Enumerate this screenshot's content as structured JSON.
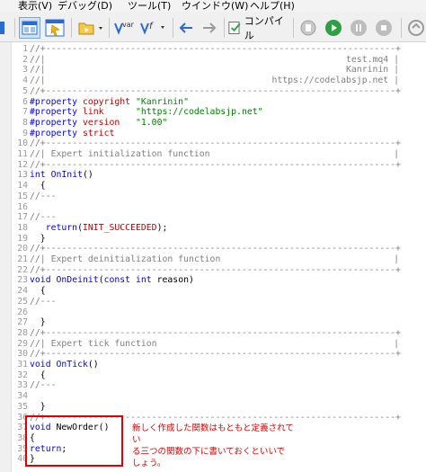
{
  "menubar": {
    "items": [
      "表示(V)",
      "デバッグ(D)",
      "ツール(T)",
      "ウインドウ(W)",
      "ヘルプ(H)"
    ]
  },
  "toolbar": {
    "var_label": "var",
    "f_label": "f",
    "compile_label": "コンパイル",
    "icons": [
      "view-icon",
      "navigator-icon",
      "folder-icon",
      "var-insert-icon",
      "function-insert-icon",
      "back-arrow-icon",
      "forward-arrow-icon",
      "compile-icon",
      "debug-icon",
      "play-icon",
      "pause-icon",
      "stop-icon"
    ]
  },
  "editor": {
    "lines": [
      {
        "n": "1",
        "segments": [
          {
            "t": "//+------------------------------------------------------------------+",
            "c": "com"
          }
        ]
      },
      {
        "n": "2",
        "segments": [
          {
            "t": "//|",
            "c": "com"
          }
        ],
        "right": "test.mq4 |"
      },
      {
        "n": "3",
        "segments": [
          {
            "t": "//|",
            "c": "com"
          }
        ],
        "right": "Kanrinin |"
      },
      {
        "n": "4",
        "segments": [
          {
            "t": "//|",
            "c": "com"
          }
        ],
        "right": "https://codelabsjp.net |"
      },
      {
        "n": "5",
        "segments": [
          {
            "t": "//+------------------------------------------------------------------+",
            "c": "com"
          }
        ]
      },
      {
        "n": "6",
        "segments": [
          {
            "t": "#property",
            "c": "dir"
          },
          {
            "t": " copyright ",
            "c": "red"
          },
          {
            "t": "\"Kanrinin\"",
            "c": "str"
          }
        ]
      },
      {
        "n": "7",
        "segments": [
          {
            "t": "#property",
            "c": "dir"
          },
          {
            "t": " link      ",
            "c": "red"
          },
          {
            "t": "\"https://codelabsjp.net\"",
            "c": "str"
          }
        ]
      },
      {
        "n": "8",
        "segments": [
          {
            "t": "#property",
            "c": "dir"
          },
          {
            "t": " version   ",
            "c": "red"
          },
          {
            "t": "\"1.00\"",
            "c": "str"
          }
        ]
      },
      {
        "n": "9",
        "segments": [
          {
            "t": "#property",
            "c": "dir"
          },
          {
            "t": " strict",
            "c": "red"
          }
        ]
      },
      {
        "n": "10",
        "segments": [
          {
            "t": "//+------------------------------------------------------------------+",
            "c": "com"
          }
        ]
      },
      {
        "n": "11",
        "segments": [
          {
            "t": "//| Expert initialization function",
            "c": "com"
          }
        ],
        "right": "|"
      },
      {
        "n": "12",
        "segments": [
          {
            "t": "//+------------------------------------------------------------------+",
            "c": "com"
          }
        ]
      },
      {
        "n": "13",
        "segments": [
          {
            "t": "int",
            "c": "kw"
          },
          {
            "t": " ",
            "c": "pl"
          },
          {
            "t": "OnInit",
            "c": "fn"
          },
          {
            "t": "()",
            "c": "pl"
          }
        ]
      },
      {
        "n": "14",
        "segments": [
          {
            "t": "  {",
            "c": "pl"
          }
        ]
      },
      {
        "n": "15",
        "segments": [
          {
            "t": "//---",
            "c": "com"
          }
        ]
      },
      {
        "n": "16",
        "segments": [
          {
            "t": "",
            "c": "pl"
          }
        ]
      },
      {
        "n": "17",
        "segments": [
          {
            "t": "//---",
            "c": "com"
          }
        ]
      },
      {
        "n": "18",
        "segments": [
          {
            "t": "   return",
            "c": "kw"
          },
          {
            "t": "(",
            "c": "pl"
          },
          {
            "t": "INIT_SUCCEEDED",
            "c": "red"
          },
          {
            "t": ");",
            "c": "pl"
          }
        ]
      },
      {
        "n": "19",
        "segments": [
          {
            "t": "  }",
            "c": "pl"
          }
        ]
      },
      {
        "n": "20",
        "segments": [
          {
            "t": "//+------------------------------------------------------------------+",
            "c": "com"
          }
        ]
      },
      {
        "n": "21",
        "segments": [
          {
            "t": "//| Expert deinitialization function",
            "c": "com"
          }
        ],
        "right": "|"
      },
      {
        "n": "22",
        "segments": [
          {
            "t": "//+------------------------------------------------------------------+",
            "c": "com"
          }
        ]
      },
      {
        "n": "23",
        "segments": [
          {
            "t": "void",
            "c": "kw"
          },
          {
            "t": " ",
            "c": "pl"
          },
          {
            "t": "OnDeinit",
            "c": "fn"
          },
          {
            "t": "(",
            "c": "pl"
          },
          {
            "t": "const",
            "c": "kw"
          },
          {
            "t": " ",
            "c": "pl"
          },
          {
            "t": "int",
            "c": "kw"
          },
          {
            "t": " reason)",
            "c": "pl"
          }
        ]
      },
      {
        "n": "24",
        "segments": [
          {
            "t": "  {",
            "c": "pl"
          }
        ]
      },
      {
        "n": "25",
        "segments": [
          {
            "t": "//---",
            "c": "com"
          }
        ]
      },
      {
        "n": "26",
        "segments": [
          {
            "t": "",
            "c": "pl"
          }
        ]
      },
      {
        "n": "27",
        "segments": [
          {
            "t": "  }",
            "c": "pl"
          }
        ]
      },
      {
        "n": "28",
        "segments": [
          {
            "t": "//+------------------------------------------------------------------+",
            "c": "com"
          }
        ]
      },
      {
        "n": "29",
        "segments": [
          {
            "t": "//| Expert tick function",
            "c": "com"
          }
        ],
        "right": "|"
      },
      {
        "n": "30",
        "segments": [
          {
            "t": "//+------------------------------------------------------------------+",
            "c": "com"
          }
        ]
      },
      {
        "n": "31",
        "segments": [
          {
            "t": "void",
            "c": "kw"
          },
          {
            "t": " ",
            "c": "pl"
          },
          {
            "t": "OnTick",
            "c": "fn"
          },
          {
            "t": "()",
            "c": "pl"
          }
        ]
      },
      {
        "n": "32",
        "segments": [
          {
            "t": "  {",
            "c": "pl"
          }
        ]
      },
      {
        "n": "33",
        "segments": [
          {
            "t": "//---",
            "c": "com"
          }
        ]
      },
      {
        "n": "34",
        "segments": [
          {
            "t": "",
            "c": "pl"
          }
        ]
      },
      {
        "n": "35",
        "segments": [
          {
            "t": "  }",
            "c": "pl"
          }
        ]
      },
      {
        "n": "36",
        "segments": [
          {
            "t": "//+------------------------------------------------------------------+",
            "c": "com"
          }
        ]
      },
      {
        "n": "37",
        "segments": [
          {
            "t": "void",
            "c": "kw"
          },
          {
            "t": " NewOrder()",
            "c": "pl"
          }
        ]
      },
      {
        "n": "38",
        "segments": [
          {
            "t": "{",
            "c": "pl"
          }
        ]
      },
      {
        "n": "39",
        "segments": [
          {
            "t": "return",
            "c": "kw"
          },
          {
            "t": ";",
            "c": "pl"
          }
        ]
      },
      {
        "n": "40",
        "segments": [
          {
            "t": "}",
            "c": "pl"
          }
        ]
      }
    ]
  },
  "annotation": {
    "text": "新しく作成した関数はもともと定義されてい\nる三つの関数の下に書いておくといいで\nしょう。"
  }
}
